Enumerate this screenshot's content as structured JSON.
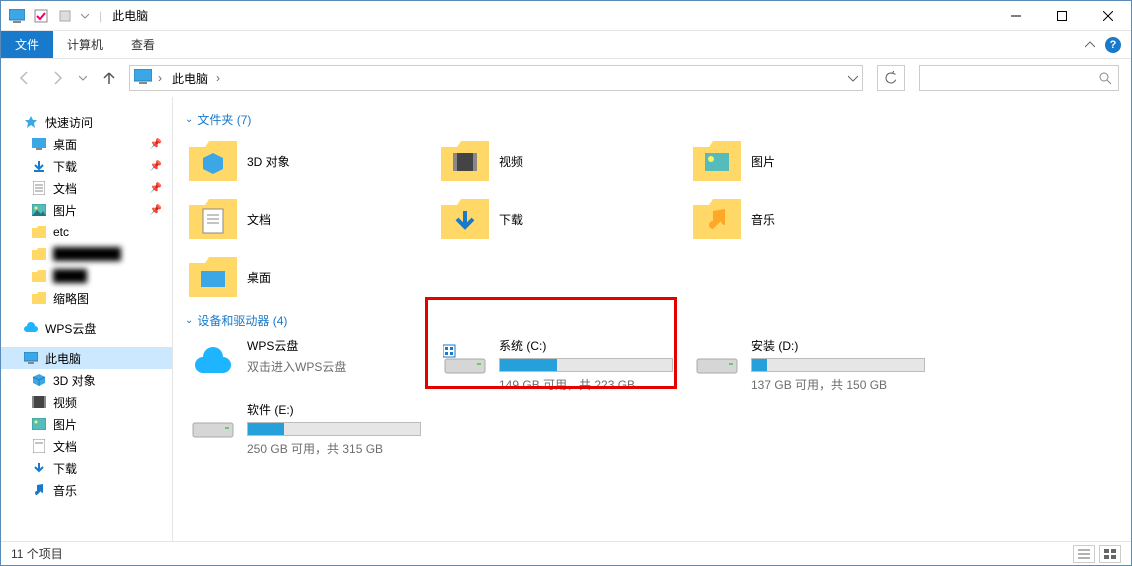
{
  "titlebar": {
    "title": "此电脑"
  },
  "ribbon": {
    "file": "文件",
    "computer": "计算机",
    "view": "查看"
  },
  "breadcrumb": {
    "item": "此电脑"
  },
  "sidebar": {
    "quick": "快速访问",
    "desktop": "桌面",
    "downloads": "下载",
    "documents": "文档",
    "pictures": "图片",
    "etc": "etc",
    "blurred1": "████████",
    "blurred2": "████",
    "thumbnails": "缩略图",
    "wps": "WPS云盘",
    "thispc": "此电脑",
    "objects3d": "3D 对象",
    "videos": "视频",
    "pictures2": "图片",
    "documents2": "文档",
    "downloads2": "下载",
    "music": "音乐"
  },
  "sections": {
    "folders": "文件夹 (7)",
    "drives": "设备和驱动器 (4)"
  },
  "folders": {
    "objects3d": "3D 对象",
    "videos": "视频",
    "pictures": "图片",
    "documents": "文档",
    "downloads": "下载",
    "music": "音乐",
    "desktop": "桌面"
  },
  "drives": {
    "wps": {
      "name": "WPS云盘",
      "sub": "双击进入WPS云盘"
    },
    "c": {
      "name": "系统 (C:)",
      "text": "149 GB 可用，共 223 GB",
      "used_pct": 33
    },
    "d": {
      "name": "安装 (D:)",
      "text": "137 GB 可用，共 150 GB",
      "used_pct": 9
    },
    "e": {
      "name": "软件 (E:)",
      "text": "250 GB 可用，共 315 GB",
      "used_pct": 21
    }
  },
  "statusbar": {
    "text": "11 个项目"
  }
}
